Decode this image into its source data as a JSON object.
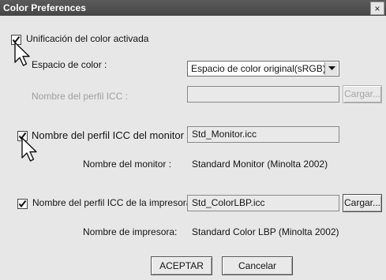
{
  "window": {
    "title": "Color Preferences",
    "close_glyph": "×"
  },
  "color_management": {
    "checkbox_label": "Unificación del color activada",
    "checked": true
  },
  "color_space": {
    "label": "Espacio de color :",
    "selected": "Espacio de color original(sRGB)"
  },
  "icc_profile": {
    "label": "Nombre del perfil ICC :",
    "value": "",
    "load_button": "Cargar..."
  },
  "monitor": {
    "checkbox_label": "Nombre del perfil ICC del monitor :",
    "checked": true,
    "profile": "Std_Monitor.icc",
    "name_label": "Nombre del monitor :",
    "name_value": "Standard Monitor (Minolta 2002)"
  },
  "printer": {
    "checkbox_label": "Nombre del perfil ICC de la impresora",
    "checked": true,
    "profile": "Std_ColorLBP.icc",
    "load_button": "Cargar...",
    "name_label": "Nombre de impresora:",
    "name_value": "Standard Color LBP (Minolta 2002)"
  },
  "buttons": {
    "ok": "ACEPTAR",
    "cancel": "Cancelar"
  },
  "icons": {
    "checkmark": "check-mark-icon",
    "dropdown": "chevron-down-icon",
    "cursor": "mouse-pointer-icon"
  }
}
